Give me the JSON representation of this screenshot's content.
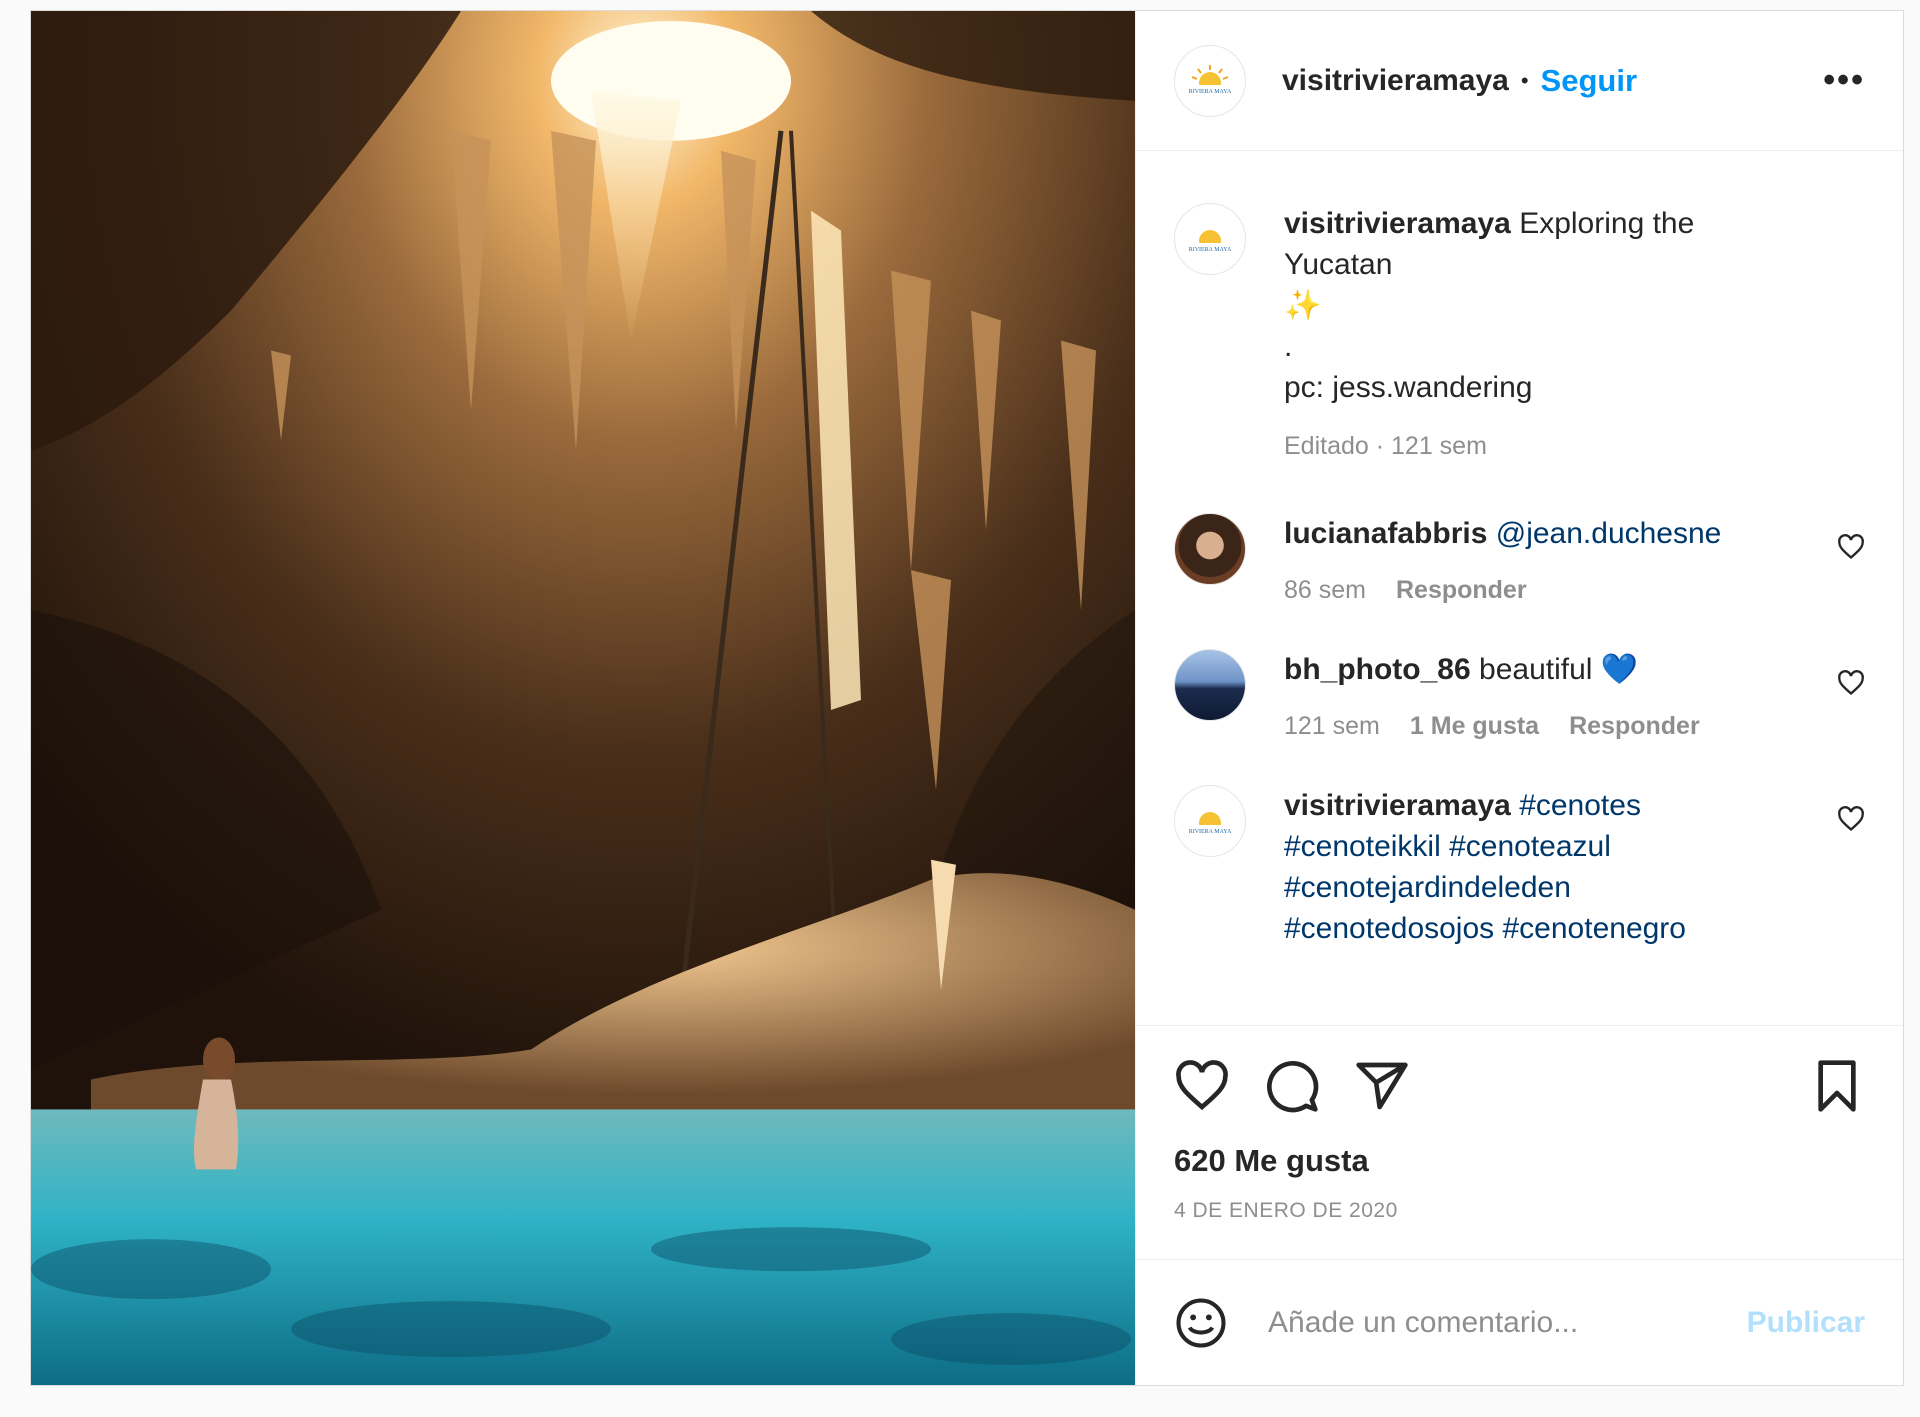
{
  "header": {
    "username": "visitrivieramaya",
    "separator": "•",
    "follow_label": "Seguir",
    "more_label": "•••",
    "avatar_logo_text": "RIVIERA MAYA"
  },
  "caption": {
    "username": "visitrivieramaya",
    "text": "Exploring the Yucatan",
    "emoji": "✨",
    "line_dot": ".",
    "credit": "pc: jess.wandering",
    "edited": "Editado",
    "time": "121 sem"
  },
  "comments": [
    {
      "username": "lucianafabbris",
      "text": "@jean.duchesne",
      "time": "86 sem",
      "likes": "",
      "reply_label": "Responder"
    },
    {
      "username": "bh_photo_86",
      "text": "beautiful",
      "emoji": "💙",
      "time": "121 sem",
      "likes": "1 Me gusta",
      "reply_label": "Responder"
    },
    {
      "username": "visitrivieramaya",
      "line1": "#cenotes",
      "line2": "#cenoteikkil #cenoteazul",
      "line3": "#cenotejardindeleden",
      "line4": "#cenotedosojos #cenotenegro"
    }
  ],
  "likes_count": "620 Me gusta",
  "date": "4 DE ENERO DE 2020",
  "add_comment": {
    "placeholder": "Añade un comentario...",
    "publish_label": "Publicar"
  },
  "icons": [
    "heart-icon",
    "comment-icon",
    "share-icon",
    "bookmark-icon",
    "emoji-icon",
    "more-options-icon"
  ],
  "colors": {
    "link_blue": "#0095f6",
    "publish_disabled": "#b2dffc",
    "meta_gray": "#8e8e8e",
    "heart_blue": "#1877c9"
  }
}
